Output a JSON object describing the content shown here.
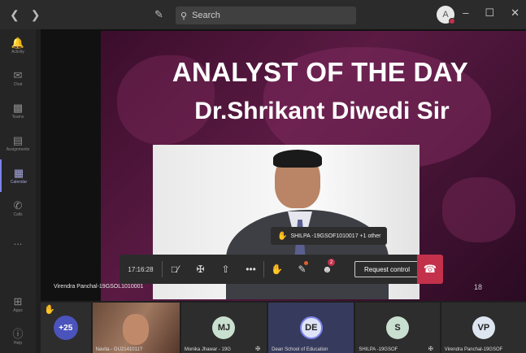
{
  "titlebar": {
    "back_icon": "chevron-left-icon",
    "forward_icon": "chevron-right-icon",
    "compose_icon": "compose-icon",
    "search_placeholder": "Search",
    "avatar_initial": "A",
    "status_color": "#c4314b"
  },
  "rail": {
    "items": [
      {
        "label": "Activity",
        "icon": "bell-icon"
      },
      {
        "label": "Chat",
        "icon": "chat-icon"
      },
      {
        "label": "Teams",
        "icon": "teams-icon"
      },
      {
        "label": "Assignments",
        "icon": "assignments-icon"
      },
      {
        "label": "Calendar",
        "icon": "calendar-icon",
        "active": true
      },
      {
        "label": "Calls",
        "icon": "phone-icon"
      },
      {
        "label": "...",
        "icon": "more-icon"
      }
    ],
    "bottom": [
      {
        "label": "Apps",
        "icon": "apps-icon"
      },
      {
        "label": "Help",
        "icon": "help-icon"
      }
    ]
  },
  "slide": {
    "title_line1": "ANALYST OF THE DAY",
    "title_line2": "Dr.Shrikant Diwedi Sir",
    "page_number": "18"
  },
  "presenter_name": "Virendra Panchal-19GSOL1010001",
  "raised_hand_tip": "SHILPA -19GSOF1010017 +1 other",
  "callbar": {
    "timer": "17:16:28",
    "chat_badge": "2",
    "request_control_label": "Request control",
    "accent_hangup": "#c4314b"
  },
  "participants": [
    {
      "type": "more",
      "label": "+25"
    },
    {
      "type": "video",
      "name": "Navita - GU2141011?"
    },
    {
      "type": "initials",
      "initials": "MJ",
      "name": "Monika Jhawar - 19G",
      "color": "#c9e0d0"
    },
    {
      "type": "initials",
      "initials": "DE",
      "name": "Dean School of Education",
      "color": "#dfe3f6"
    },
    {
      "type": "initials",
      "initials": "S",
      "name": "SHILPA -19GSOF",
      "color": "#c9e0d0",
      "hand": true
    },
    {
      "type": "initials",
      "initials": "VP",
      "name": "Virendra Panchal-19GSOF",
      "color": "#dde6f0"
    }
  ]
}
